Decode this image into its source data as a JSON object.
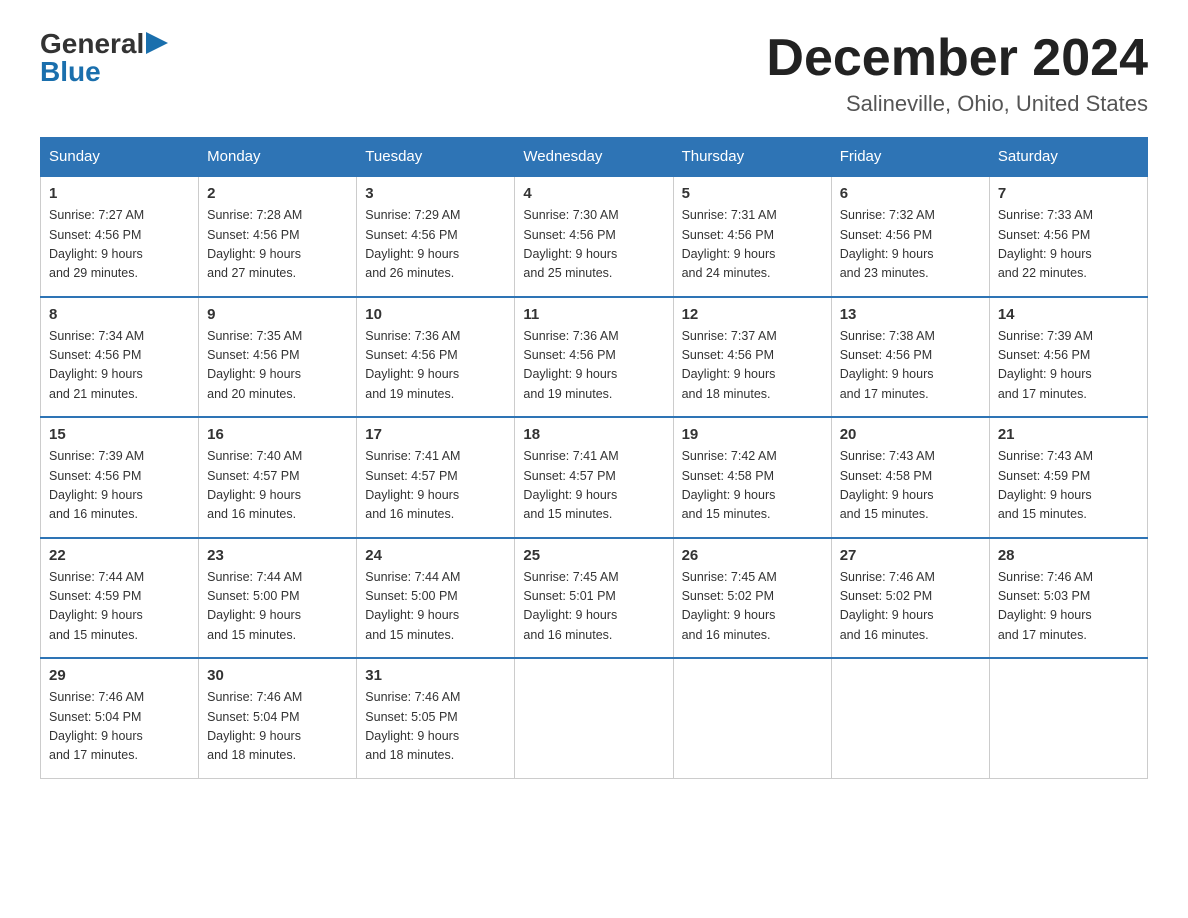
{
  "logo": {
    "general": "General",
    "blue": "Blue"
  },
  "header": {
    "month_year": "December 2024",
    "location": "Salineville, Ohio, United States"
  },
  "days_of_week": [
    "Sunday",
    "Monday",
    "Tuesday",
    "Wednesday",
    "Thursday",
    "Friday",
    "Saturday"
  ],
  "weeks": [
    [
      {
        "day": "1",
        "sunrise": "7:27 AM",
        "sunset": "4:56 PM",
        "daylight": "9 hours and 29 minutes."
      },
      {
        "day": "2",
        "sunrise": "7:28 AM",
        "sunset": "4:56 PM",
        "daylight": "9 hours and 27 minutes."
      },
      {
        "day": "3",
        "sunrise": "7:29 AM",
        "sunset": "4:56 PM",
        "daylight": "9 hours and 26 minutes."
      },
      {
        "day": "4",
        "sunrise": "7:30 AM",
        "sunset": "4:56 PM",
        "daylight": "9 hours and 25 minutes."
      },
      {
        "day": "5",
        "sunrise": "7:31 AM",
        "sunset": "4:56 PM",
        "daylight": "9 hours and 24 minutes."
      },
      {
        "day": "6",
        "sunrise": "7:32 AM",
        "sunset": "4:56 PM",
        "daylight": "9 hours and 23 minutes."
      },
      {
        "day": "7",
        "sunrise": "7:33 AM",
        "sunset": "4:56 PM",
        "daylight": "9 hours and 22 minutes."
      }
    ],
    [
      {
        "day": "8",
        "sunrise": "7:34 AM",
        "sunset": "4:56 PM",
        "daylight": "9 hours and 21 minutes."
      },
      {
        "day": "9",
        "sunrise": "7:35 AM",
        "sunset": "4:56 PM",
        "daylight": "9 hours and 20 minutes."
      },
      {
        "day": "10",
        "sunrise": "7:36 AM",
        "sunset": "4:56 PM",
        "daylight": "9 hours and 19 minutes."
      },
      {
        "day": "11",
        "sunrise": "7:36 AM",
        "sunset": "4:56 PM",
        "daylight": "9 hours and 19 minutes."
      },
      {
        "day": "12",
        "sunrise": "7:37 AM",
        "sunset": "4:56 PM",
        "daylight": "9 hours and 18 minutes."
      },
      {
        "day": "13",
        "sunrise": "7:38 AM",
        "sunset": "4:56 PM",
        "daylight": "9 hours and 17 minutes."
      },
      {
        "day": "14",
        "sunrise": "7:39 AM",
        "sunset": "4:56 PM",
        "daylight": "9 hours and 17 minutes."
      }
    ],
    [
      {
        "day": "15",
        "sunrise": "7:39 AM",
        "sunset": "4:56 PM",
        "daylight": "9 hours and 16 minutes."
      },
      {
        "day": "16",
        "sunrise": "7:40 AM",
        "sunset": "4:57 PM",
        "daylight": "9 hours and 16 minutes."
      },
      {
        "day": "17",
        "sunrise": "7:41 AM",
        "sunset": "4:57 PM",
        "daylight": "9 hours and 16 minutes."
      },
      {
        "day": "18",
        "sunrise": "7:41 AM",
        "sunset": "4:57 PM",
        "daylight": "9 hours and 15 minutes."
      },
      {
        "day": "19",
        "sunrise": "7:42 AM",
        "sunset": "4:58 PM",
        "daylight": "9 hours and 15 minutes."
      },
      {
        "day": "20",
        "sunrise": "7:43 AM",
        "sunset": "4:58 PM",
        "daylight": "9 hours and 15 minutes."
      },
      {
        "day": "21",
        "sunrise": "7:43 AM",
        "sunset": "4:59 PM",
        "daylight": "9 hours and 15 minutes."
      }
    ],
    [
      {
        "day": "22",
        "sunrise": "7:44 AM",
        "sunset": "4:59 PM",
        "daylight": "9 hours and 15 minutes."
      },
      {
        "day": "23",
        "sunrise": "7:44 AM",
        "sunset": "5:00 PM",
        "daylight": "9 hours and 15 minutes."
      },
      {
        "day": "24",
        "sunrise": "7:44 AM",
        "sunset": "5:00 PM",
        "daylight": "9 hours and 15 minutes."
      },
      {
        "day": "25",
        "sunrise": "7:45 AM",
        "sunset": "5:01 PM",
        "daylight": "9 hours and 16 minutes."
      },
      {
        "day": "26",
        "sunrise": "7:45 AM",
        "sunset": "5:02 PM",
        "daylight": "9 hours and 16 minutes."
      },
      {
        "day": "27",
        "sunrise": "7:46 AM",
        "sunset": "5:02 PM",
        "daylight": "9 hours and 16 minutes."
      },
      {
        "day": "28",
        "sunrise": "7:46 AM",
        "sunset": "5:03 PM",
        "daylight": "9 hours and 17 minutes."
      }
    ],
    [
      {
        "day": "29",
        "sunrise": "7:46 AM",
        "sunset": "5:04 PM",
        "daylight": "9 hours and 17 minutes."
      },
      {
        "day": "30",
        "sunrise": "7:46 AM",
        "sunset": "5:04 PM",
        "daylight": "9 hours and 18 minutes."
      },
      {
        "day": "31",
        "sunrise": "7:46 AM",
        "sunset": "5:05 PM",
        "daylight": "9 hours and 18 minutes."
      },
      null,
      null,
      null,
      null
    ]
  ]
}
